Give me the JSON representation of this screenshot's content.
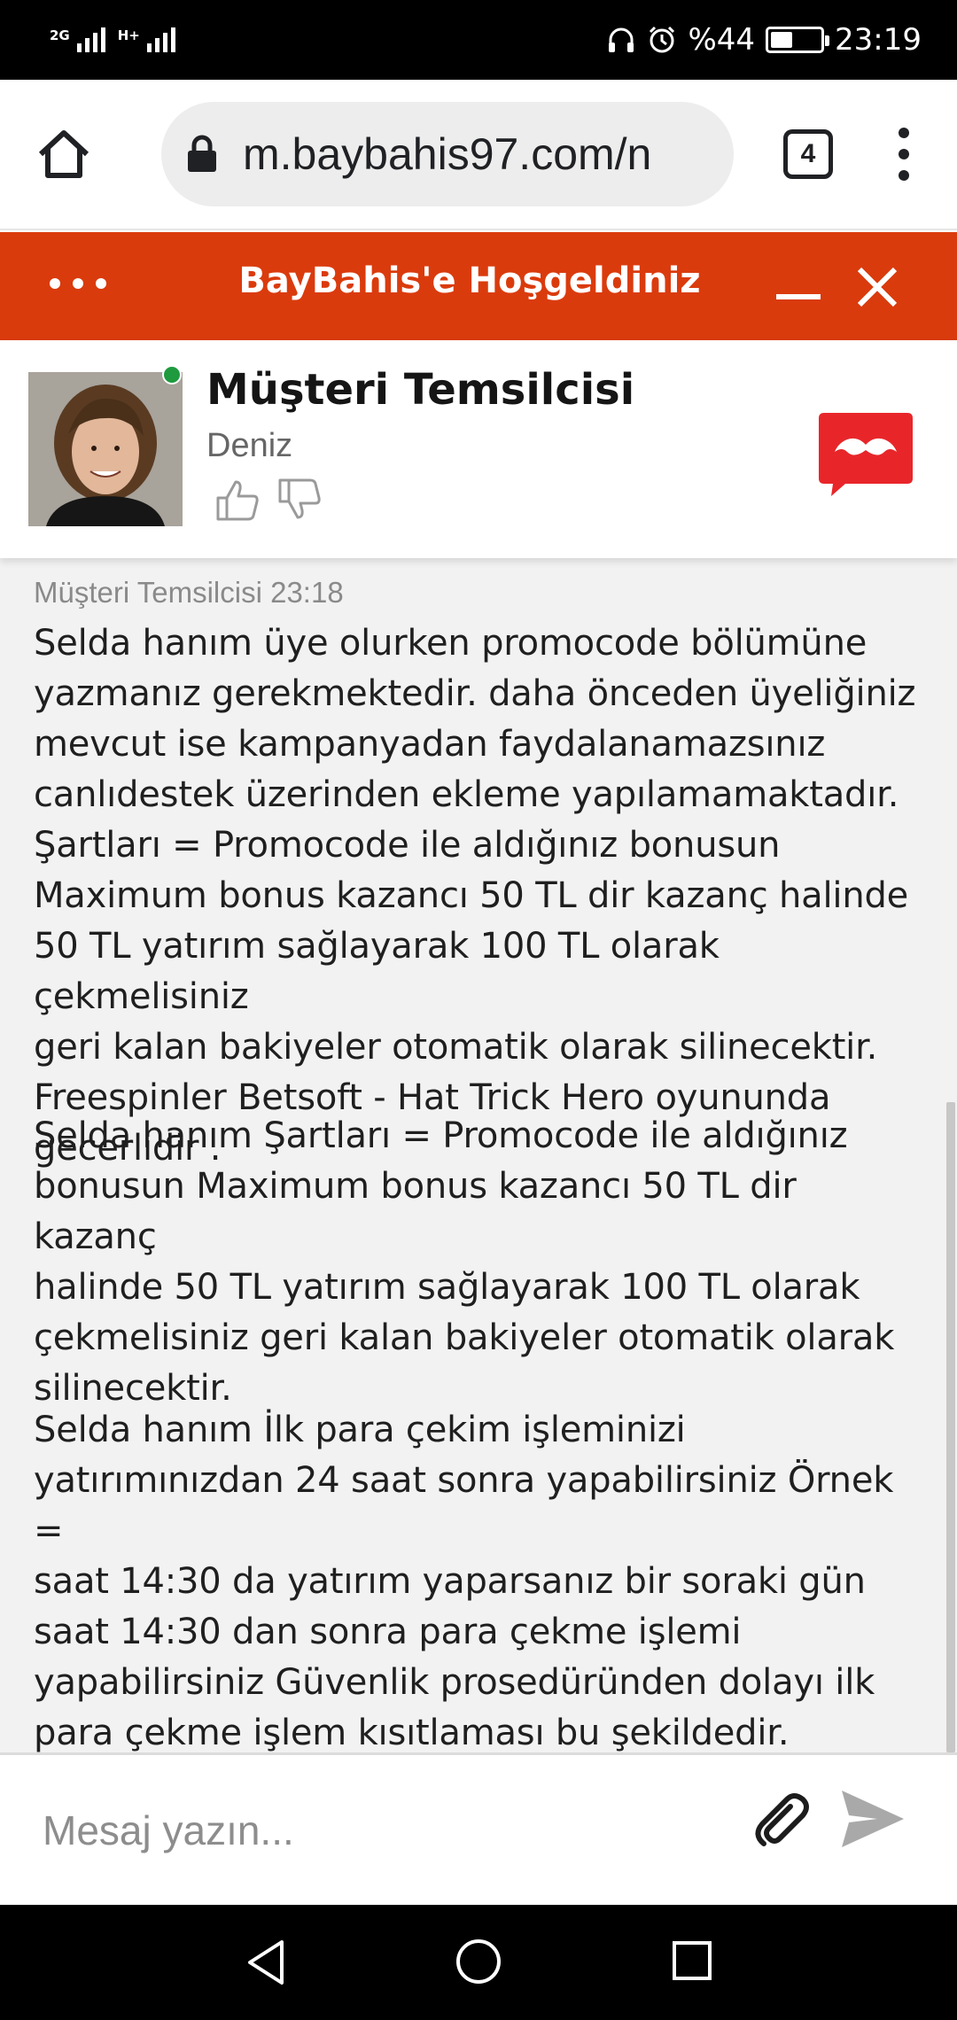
{
  "status_bar": {
    "network_1": "2G",
    "network_2": "H+",
    "battery": "%44",
    "battery_level": 0.44,
    "time": "23:19"
  },
  "browser": {
    "url": "m.baybahis97.com/n",
    "tab_count": "4"
  },
  "chat_header": {
    "title": "BayBahis'e Hoşgeldiniz"
  },
  "agent": {
    "role": "Müşteri Temsilcisi",
    "name": "Deniz",
    "status_color": "#1f9a3f"
  },
  "messages": {
    "meta": "Müşteri Temsilcisi 23:18",
    "items": [
      "Selda hanım üye olurken promocode bölümüne\nyazmanız gerekmektedir. daha önceden üyeliğiniz\nmevcut ise kampanyadan faydalanamazsınız\ncanlıdestek üzerinden ekleme yapılamamaktadır.\nŞartları = Promocode ile aldığınız bonusun\nMaximum bonus kazancı 50 TL dir kazanç halinde\n50 TL yatırım sağlayarak 100 TL olarak çekmelisiniz\ngeri kalan bakiyeler otomatik olarak silinecektir.\nFreespinler Betsoft - Hat Trick Hero oyununda\ngecerlidir .",
      "Selda hanım Şartları = Promocode ile aldığınız\nbonusun Maximum bonus kazancı 50 TL dir kazanç\nhalinde 50 TL yatırım sağlayarak 100 TL olarak\nçekmelisiniz geri kalan bakiyeler otomatik olarak\nsilinecektir.",
      "Selda hanım İlk para çekim işleminizi\nyatırımınızdan 24 saat sonra yapabilirsiniz Örnek =\nsaat 14:30 da yatırım yaparsanız bir soraki gün\nsaat 14:30 dan sonra para çekme işlemi\nyapabilirsiniz Güvenlik prosedüründen dolayı ilk\npara çekme işlem kısıtlaması bu şekildedir."
    ]
  },
  "composer": {
    "placeholder": "Mesaj yazın..."
  },
  "colors": {
    "accent": "#da3b0d",
    "brand_logo": "#e8262a"
  }
}
